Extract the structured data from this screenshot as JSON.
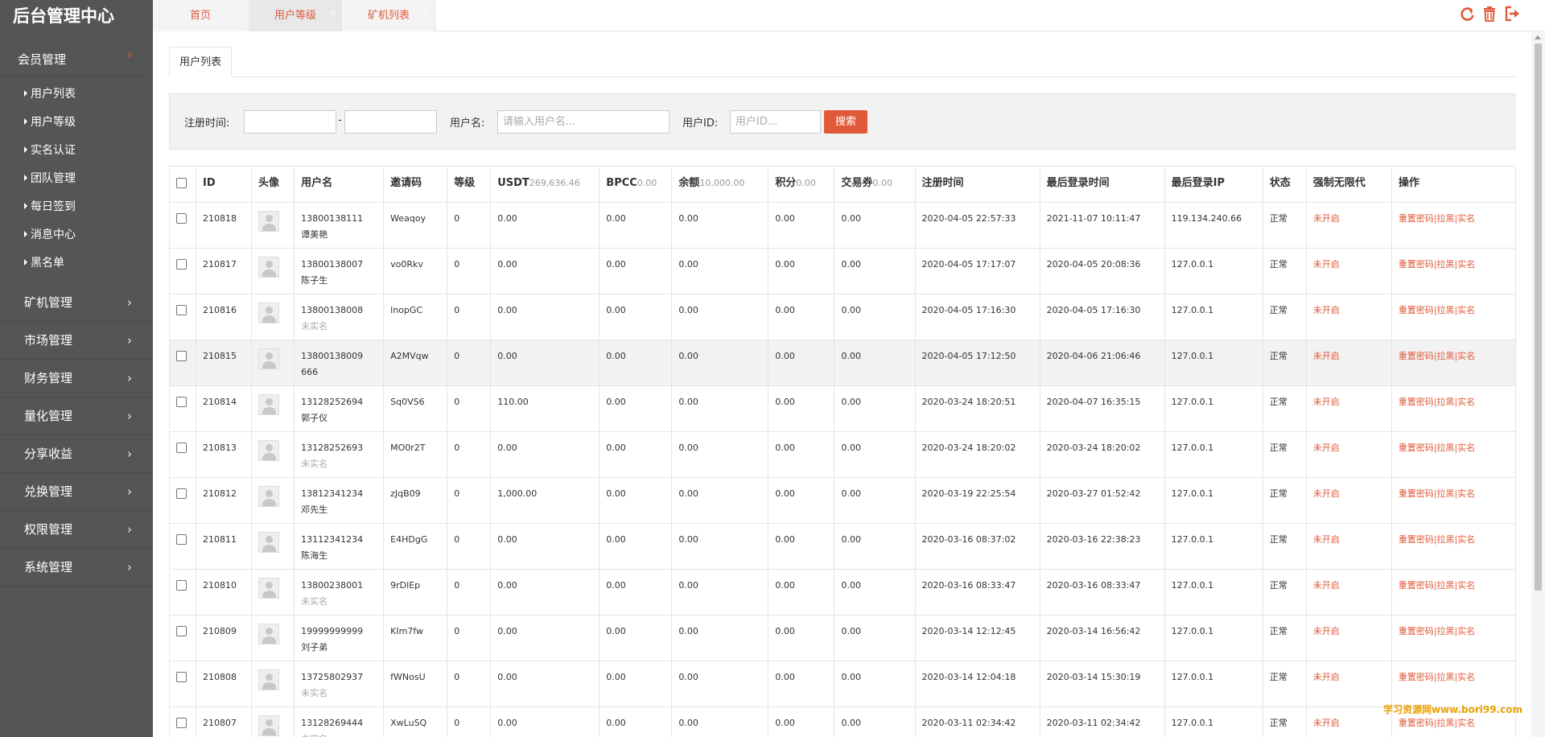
{
  "app": {
    "title": "后台管理中心"
  },
  "sidebar": {
    "open_group": "会员管理",
    "sub_items": [
      "用户列表",
      "用户等级",
      "实名认证",
      "团队管理",
      "每日签到",
      "消息中心",
      "黑名单"
    ],
    "groups": [
      "矿机管理",
      "市场管理",
      "财务管理",
      "量化管理",
      "分享收益",
      "兑换管理",
      "权限管理",
      "系统管理"
    ]
  },
  "tabs": [
    {
      "label": "首页",
      "closable": false
    },
    {
      "label": "用户等级",
      "closable": true
    },
    {
      "label": "矿机列表",
      "closable": true
    }
  ],
  "tab_close_glyph": "×",
  "top_icons": [
    "refresh-icon",
    "trash-icon",
    "logout-icon"
  ],
  "page_tab": "用户列表",
  "search": {
    "reg_time_label": "注册时间:",
    "range_sep": "-",
    "username_label": "用户名:",
    "username_placeholder": "请输入用户名...",
    "userid_label": "用户ID:",
    "userid_placeholder": "用户ID...",
    "search_button": "搜索"
  },
  "table": {
    "headers": {
      "id": "ID",
      "avatar": "头像",
      "username": "用户名",
      "invite": "邀请码",
      "level": "等级",
      "usdt": "USDT",
      "usdt_total": "269,636.46",
      "bpcc": "BPCC",
      "bpcc_total": "0.00",
      "balance": "余额",
      "balance_total": "10,000.00",
      "points": "积分",
      "points_total": "0.00",
      "coupon": "交易券",
      "coupon_total": "0.00",
      "reg_time": "注册时间",
      "last_login": "最后登录时间",
      "last_ip": "最后登录IP",
      "status": "状态",
      "force": "强制无限代",
      "ops": "操作"
    },
    "ops_labels": {
      "reset": "重置密码",
      "sep": "|",
      "block": "拉黑",
      "real": "实名"
    },
    "rows": [
      {
        "id": "210818",
        "phone": "13800138111",
        "name": "谭美艳",
        "named": true,
        "invite": "Weaqoy",
        "level": "0",
        "usdt": "0.00",
        "bpcc": "0.00",
        "balance": "0.00",
        "points": "0.00",
        "coupon": "0.00",
        "reg": "2020-04-05 22:57:33",
        "login": "2021-11-07 10:11:47",
        "ip": "119.134.240.66",
        "status": "正常",
        "force": "未开启"
      },
      {
        "id": "210817",
        "phone": "13800138007",
        "name": "陈子生",
        "named": true,
        "invite": "vo0Rkv",
        "level": "0",
        "usdt": "0.00",
        "bpcc": "0.00",
        "balance": "0.00",
        "points": "0.00",
        "coupon": "0.00",
        "reg": "2020-04-05 17:17:07",
        "login": "2020-04-05 20:08:36",
        "ip": "127.0.0.1",
        "status": "正常",
        "force": "未开启"
      },
      {
        "id": "210816",
        "phone": "13800138008",
        "name": "未实名",
        "named": false,
        "invite": "lnopGC",
        "level": "0",
        "usdt": "0.00",
        "bpcc": "0.00",
        "balance": "0.00",
        "points": "0.00",
        "coupon": "0.00",
        "reg": "2020-04-05 17:16:30",
        "login": "2020-04-05 17:16:30",
        "ip": "127.0.0.1",
        "status": "正常",
        "force": "未开启"
      },
      {
        "id": "210815",
        "phone": "13800138009",
        "name": "666",
        "named": true,
        "invite": "A2MVqw",
        "level": "0",
        "usdt": "0.00",
        "bpcc": "0.00",
        "balance": "0.00",
        "points": "0.00",
        "coupon": "0.00",
        "reg": "2020-04-05 17:12:50",
        "login": "2020-04-06 21:06:46",
        "ip": "127.0.0.1",
        "status": "正常",
        "force": "未开启",
        "highlight": true
      },
      {
        "id": "210814",
        "phone": "13128252694",
        "name": "郭子仪",
        "named": true,
        "invite": "Sq0VS6",
        "level": "0",
        "usdt": "110.00",
        "bpcc": "0.00",
        "balance": "0.00",
        "points": "0.00",
        "coupon": "0.00",
        "reg": "2020-03-24 18:20:51",
        "login": "2020-04-07 16:35:15",
        "ip": "127.0.0.1",
        "status": "正常",
        "force": "未开启"
      },
      {
        "id": "210813",
        "phone": "13128252693",
        "name": "未实名",
        "named": false,
        "invite": "MO0r2T",
        "level": "0",
        "usdt": "0.00",
        "bpcc": "0.00",
        "balance": "0.00",
        "points": "0.00",
        "coupon": "0.00",
        "reg": "2020-03-24 18:20:02",
        "login": "2020-03-24 18:20:02",
        "ip": "127.0.0.1",
        "status": "正常",
        "force": "未开启"
      },
      {
        "id": "210812",
        "phone": "13812341234",
        "name": "邓先生",
        "named": true,
        "invite": "zJqB09",
        "level": "0",
        "usdt": "1,000.00",
        "bpcc": "0.00",
        "balance": "0.00",
        "points": "0.00",
        "coupon": "0.00",
        "reg": "2020-03-19 22:25:54",
        "login": "2020-03-27 01:52:42",
        "ip": "127.0.0.1",
        "status": "正常",
        "force": "未开启"
      },
      {
        "id": "210811",
        "phone": "13112341234",
        "name": "陈海生",
        "named": true,
        "invite": "E4HDgG",
        "level": "0",
        "usdt": "0.00",
        "bpcc": "0.00",
        "balance": "0.00",
        "points": "0.00",
        "coupon": "0.00",
        "reg": "2020-03-16 08:37:02",
        "login": "2020-03-16 22:38:23",
        "ip": "127.0.0.1",
        "status": "正常",
        "force": "未开启"
      },
      {
        "id": "210810",
        "phone": "13800238001",
        "name": "未实名",
        "named": false,
        "invite": "9rDlEp",
        "level": "0",
        "usdt": "0.00",
        "bpcc": "0.00",
        "balance": "0.00",
        "points": "0.00",
        "coupon": "0.00",
        "reg": "2020-03-16 08:33:47",
        "login": "2020-03-16 08:33:47",
        "ip": "127.0.0.1",
        "status": "正常",
        "force": "未开启"
      },
      {
        "id": "210809",
        "phone": "19999999999",
        "name": "刘子弟",
        "named": true,
        "invite": "KIm7fw",
        "level": "0",
        "usdt": "0.00",
        "bpcc": "0.00",
        "balance": "0.00",
        "points": "0.00",
        "coupon": "0.00",
        "reg": "2020-03-14 12:12:45",
        "login": "2020-03-14 16:56:42",
        "ip": "127.0.0.1",
        "status": "正常",
        "force": "未开启"
      },
      {
        "id": "210808",
        "phone": "13725802937",
        "name": "未实名",
        "named": false,
        "invite": "fWNosU",
        "level": "0",
        "usdt": "0.00",
        "bpcc": "0.00",
        "balance": "0.00",
        "points": "0.00",
        "coupon": "0.00",
        "reg": "2020-03-14 12:04:18",
        "login": "2020-03-14 15:30:19",
        "ip": "127.0.0.1",
        "status": "正常",
        "force": "未开启"
      },
      {
        "id": "210807",
        "phone": "13128269444",
        "name": "未实名",
        "named": false,
        "invite": "XwLuSQ",
        "level": "0",
        "usdt": "0.00",
        "bpcc": "0.00",
        "balance": "0.00",
        "points": "0.00",
        "coupon": "0.00",
        "reg": "2020-03-11 02:34:42",
        "login": "2020-03-11 02:34:42",
        "ip": "127.0.0.1",
        "status": "正常",
        "force": "未开启"
      }
    ]
  },
  "watermark": "学习资源网www.bori99.com",
  "colors": {
    "accent": "#e05a3a",
    "sidebar": "#555555"
  }
}
